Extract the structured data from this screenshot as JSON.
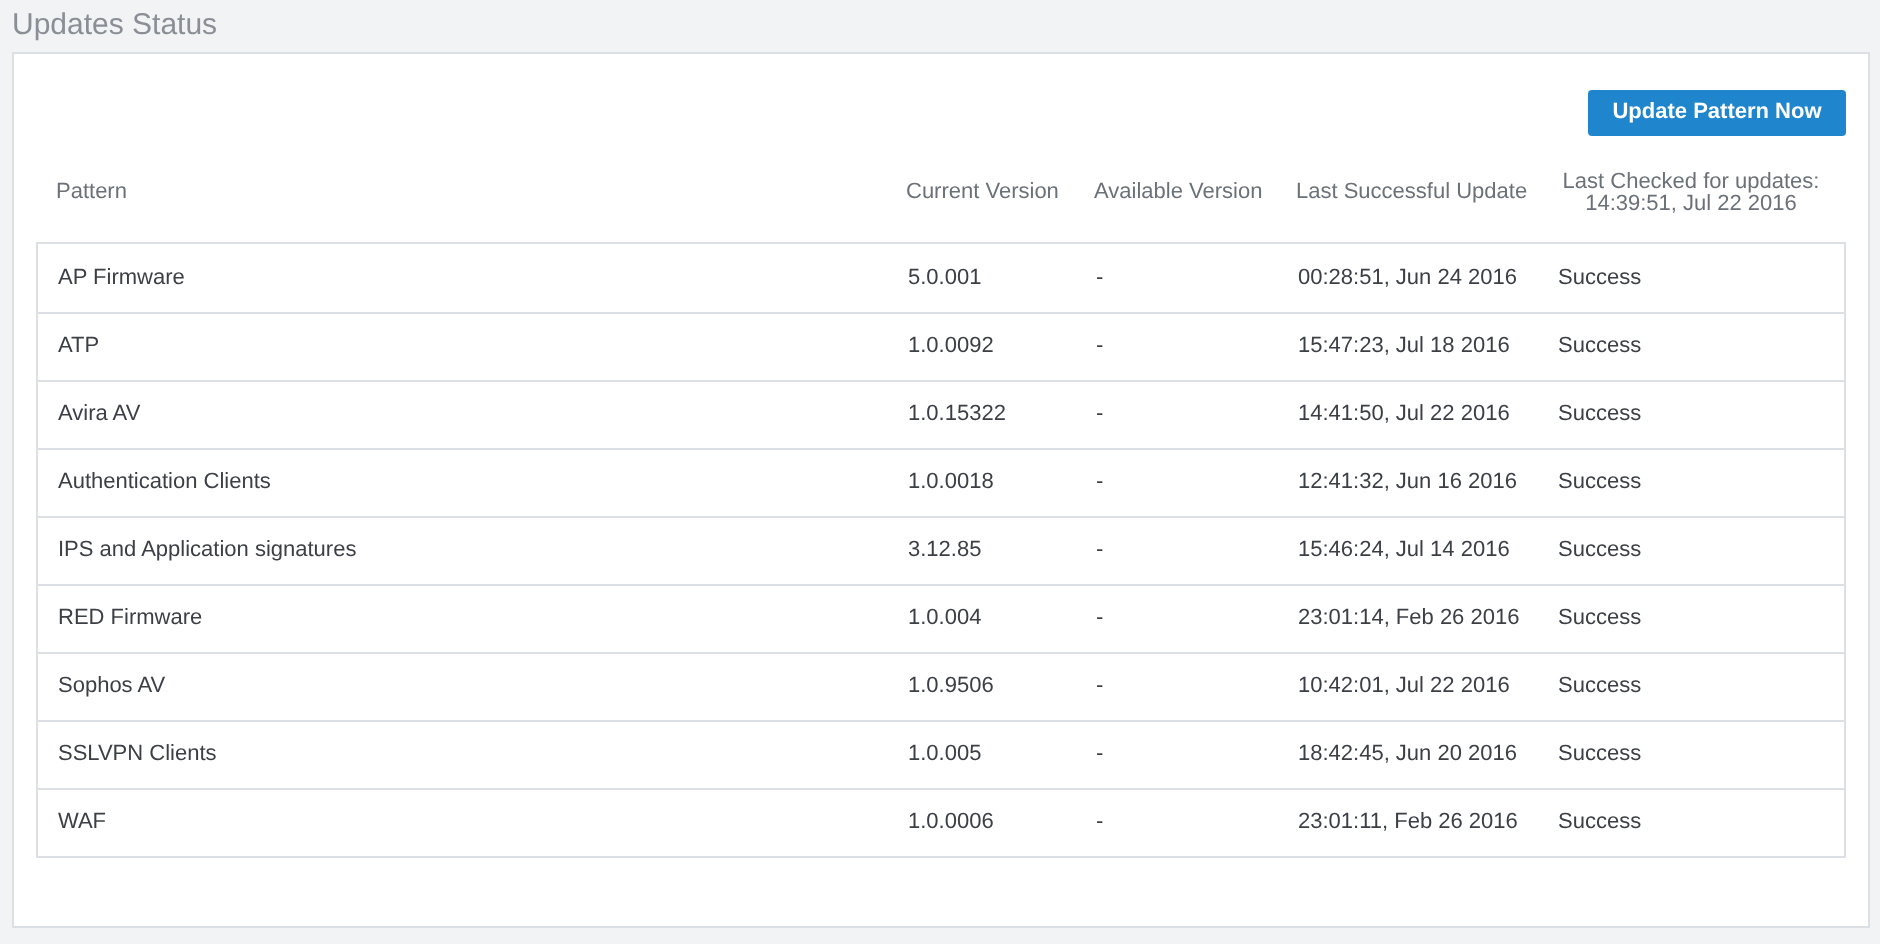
{
  "page_title": "Updates Status",
  "update_button": "Update Pattern Now",
  "table": {
    "columns": [
      "Pattern",
      "Current Version",
      "Available Version",
      "Last Successful Update"
    ],
    "last_checked_column": {
      "label": "Last Checked for updates:",
      "time": "14:39:51, Jul 22 2016"
    },
    "rows": [
      {
        "pattern": "AP Firmware",
        "current_version": "5.0.001",
        "available_version": "-",
        "last_successful_update": "00:28:51, Jun 24 2016",
        "status": "Success"
      },
      {
        "pattern": "ATP",
        "current_version": "1.0.0092",
        "available_version": "-",
        "last_successful_update": "15:47:23, Jul 18 2016",
        "status": "Success"
      },
      {
        "pattern": "Avira AV",
        "current_version": "1.0.15322",
        "available_version": "-",
        "last_successful_update": "14:41:50, Jul 22 2016",
        "status": "Success"
      },
      {
        "pattern": "Authentication Clients",
        "current_version": "1.0.0018",
        "available_version": "-",
        "last_successful_update": "12:41:32, Jun 16 2016",
        "status": "Success"
      },
      {
        "pattern": "IPS and Application signatures",
        "current_version": "3.12.85",
        "available_version": "-",
        "last_successful_update": "15:46:24, Jul 14 2016",
        "status": "Success"
      },
      {
        "pattern": "RED Firmware",
        "current_version": "1.0.004",
        "available_version": "-",
        "last_successful_update": "23:01:14, Feb 26 2016",
        "status": "Success"
      },
      {
        "pattern": "Sophos AV",
        "current_version": "1.0.9506",
        "available_version": "-",
        "last_successful_update": "10:42:01, Jul 22 2016",
        "status": "Success"
      },
      {
        "pattern": "SSLVPN Clients",
        "current_version": "1.0.005",
        "available_version": "-",
        "last_successful_update": "18:42:45, Jun 20 2016",
        "status": "Success"
      },
      {
        "pattern": "WAF",
        "current_version": "1.0.0006",
        "available_version": "-",
        "last_successful_update": "23:01:11, Feb 26 2016",
        "status": "Success"
      }
    ]
  }
}
